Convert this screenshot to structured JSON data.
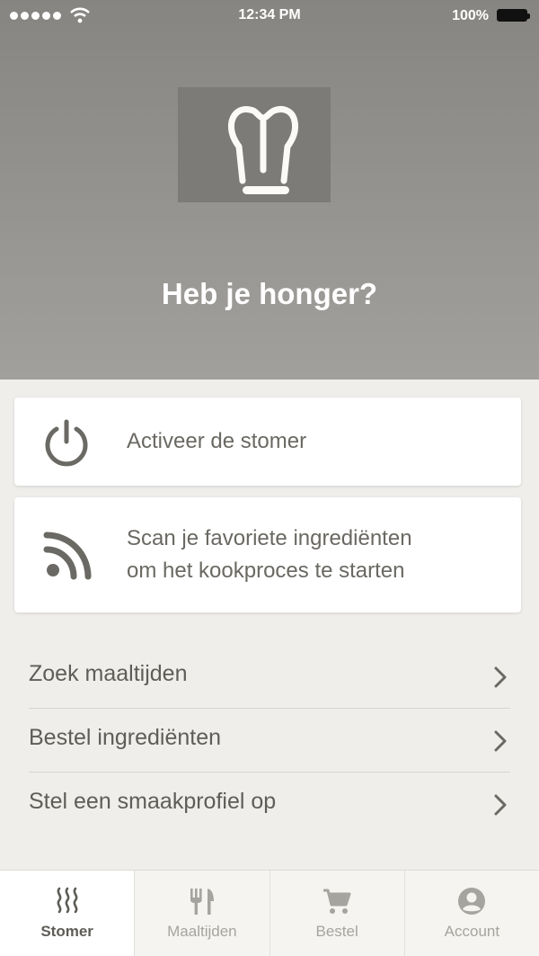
{
  "status_bar": {
    "time": "12:34 PM",
    "battery": "100%"
  },
  "hero": {
    "headline": "Heb je honger?"
  },
  "cards": [
    {
      "icon": "power-icon",
      "text": "Activeer de stomer"
    },
    {
      "icon": "rss-icon",
      "line1": "Scan je favoriete ingrediënten",
      "line2": "om het kookproces te starten"
    }
  ],
  "menu": [
    {
      "label": "Zoek maaltijden"
    },
    {
      "label": "Bestel ingrediënten"
    },
    {
      "label": "Stel een smaakprofiel op"
    }
  ],
  "tabs": [
    {
      "label": "Stomer",
      "icon": "steam-icon",
      "active": true
    },
    {
      "label": "Maaltijden",
      "icon": "cutlery-icon",
      "active": false
    },
    {
      "label": "Bestel",
      "icon": "cart-icon",
      "active": false
    },
    {
      "label": "Account",
      "icon": "account-icon",
      "active": false
    }
  ],
  "colors": {
    "hero": "#8f8d89",
    "background": "#efeeeb",
    "text": "#6a6862",
    "icon": "#6b6964"
  }
}
